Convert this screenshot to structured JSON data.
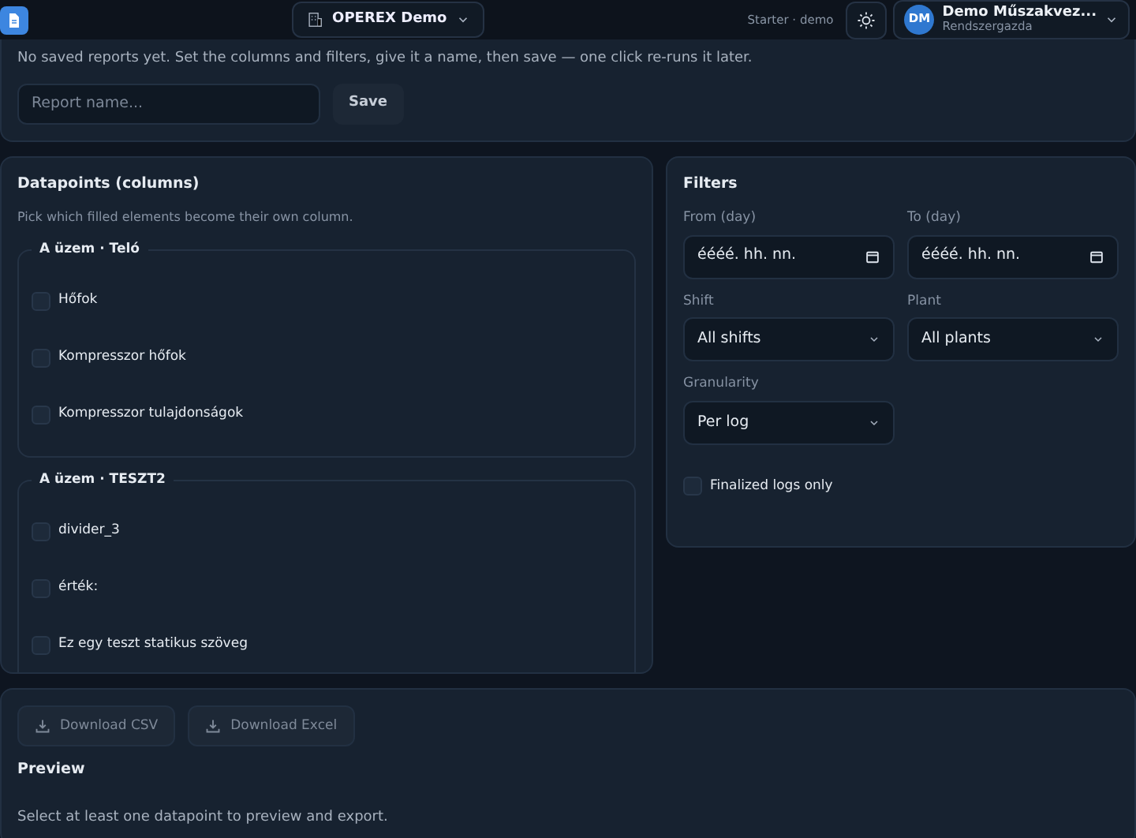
{
  "header": {
    "org": "OPEREX Demo",
    "plan": "Starter · demo",
    "user_initials": "DM",
    "user_name": "Demo Műszakvez...",
    "user_role": "Rendszergazda"
  },
  "saved_reports": {
    "message": "No saved reports yet. Set the columns and filters, give it a name, then save — one click re-runs it later.",
    "placeholder": "Report name...",
    "save": "Save"
  },
  "datapoints": {
    "title": "Datapoints (columns)",
    "hint": "Pick which filled elements become their own column.",
    "groups": [
      {
        "title": "A üzem · Teló",
        "items": [
          {
            "label": "Hőfok",
            "checked": false
          },
          {
            "label": "Kompresszor hőfok",
            "checked": false
          },
          {
            "label": "Kompresszor tulajdonságok",
            "checked": false
          }
        ]
      },
      {
        "title": "A üzem · TESZT2",
        "items": [
          {
            "label": "divider_3",
            "checked": false
          },
          {
            "label": "érték:",
            "checked": false
          },
          {
            "label": "Ez egy teszt statikus szöveg",
            "checked": false
          }
        ]
      }
    ]
  },
  "filters": {
    "title": "Filters",
    "fields": [
      {
        "kind": "date",
        "label": "From (day)",
        "value": "éééé. hh. nn."
      },
      {
        "kind": "date",
        "label": "To (day)",
        "value": "éééé. hh. nn."
      },
      {
        "kind": "select",
        "label": "Shift",
        "value": "All shifts"
      },
      {
        "kind": "select",
        "label": "Plant",
        "value": "All plants"
      },
      {
        "kind": "select",
        "label": "Granularity",
        "value": "Per log"
      }
    ],
    "finalized": {
      "label": "Finalized logs only",
      "checked": false
    }
  },
  "export": {
    "buttons": [
      {
        "label": "Download CSV",
        "disabled": true
      },
      {
        "label": "Download Excel",
        "disabled": true
      }
    ],
    "preview_title": "Preview",
    "preview_message": "Select at least one datapoint to preview and export."
  }
}
